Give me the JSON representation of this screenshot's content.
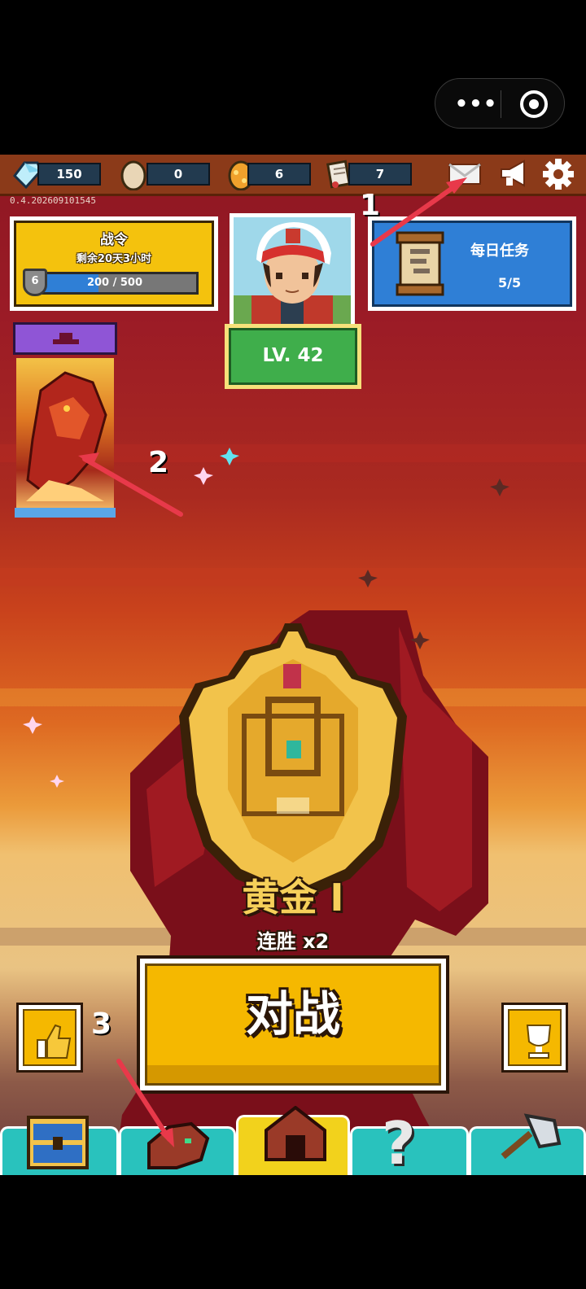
{
  "capsule": {
    "more_icon": "more-dots-icon",
    "close_icon": "target-close-icon",
    "dots": "•••"
  },
  "resources": [
    {
      "name": "diamond",
      "icon": "diamond-icon",
      "value": "150"
    },
    {
      "name": "egg",
      "icon": "egg-icon",
      "value": "0"
    },
    {
      "name": "golden-egg",
      "icon": "golden-egg-icon",
      "value": "6"
    },
    {
      "name": "scroll",
      "icon": "scroll-icon",
      "value": "7"
    }
  ],
  "top_icons": [
    "mail-icon",
    "megaphone-icon",
    "gear-icon"
  ],
  "version": "0.4.202609101545",
  "battle_pass": {
    "title": "战令",
    "remaining": "剩余20天3小时",
    "level": "6",
    "progress_text": "200 / 500",
    "progress": 0.4
  },
  "player": {
    "level": "LV. 42"
  },
  "daily": {
    "title": "每日任务",
    "count": "5/5"
  },
  "rank": {
    "name": "黄金 I",
    "streak": "连胜 x2"
  },
  "battle_button": {
    "label": "对战"
  },
  "side_buttons": {
    "left_icon": "like-icon",
    "right_icon": "trophy-icon"
  },
  "nav": [
    {
      "name": "chest",
      "icon": "chest-icon"
    },
    {
      "name": "dragon",
      "icon": "dragon-icon"
    },
    {
      "name": "home",
      "icon": "house-icon",
      "active": true
    },
    {
      "name": "help",
      "icon": "question-icon"
    },
    {
      "name": "forge",
      "icon": "axe-icon"
    }
  ],
  "annotations": [
    "1",
    "2",
    "3"
  ],
  "colors": {
    "accent_yellow": "#f5b800",
    "accent_blue": "#2f7fd6",
    "accent_green": "#3fae4b",
    "nav_teal": "#29c2bd",
    "arrow_red": "#e8394a"
  }
}
